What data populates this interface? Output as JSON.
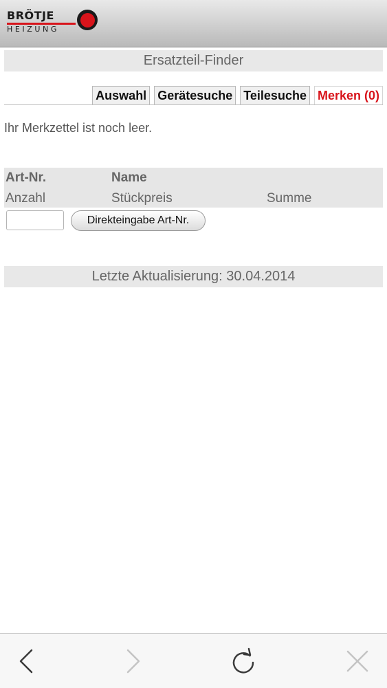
{
  "header": {
    "logo_top": "BRÖTJE",
    "logo_bottom": "HEIZUNG",
    "brand_color": "#d8141b"
  },
  "page_title": "Ersatzteil-Finder",
  "tabs": [
    {
      "label": "Auswahl",
      "active": false
    },
    {
      "label": "Gerätesuche",
      "active": false
    },
    {
      "label": "Teilesuche",
      "active": false
    },
    {
      "label": "Merken (0)",
      "active": true
    }
  ],
  "empty_message": "Ihr Merkzettel ist noch leer.",
  "table_header": {
    "row1": [
      "Art-Nr.",
      "Name"
    ],
    "row2": [
      "Anzahl",
      "Stückpreis",
      "Summe"
    ]
  },
  "direct_entry": {
    "input_value": "",
    "button_label": "Direkteingabe Art-Nr."
  },
  "last_update": "Letzte Aktualisierung: 30.04.2014",
  "browser_toolbar": {
    "icons": [
      "back-icon",
      "forward-icon",
      "reload-icon",
      "close-icon"
    ]
  }
}
